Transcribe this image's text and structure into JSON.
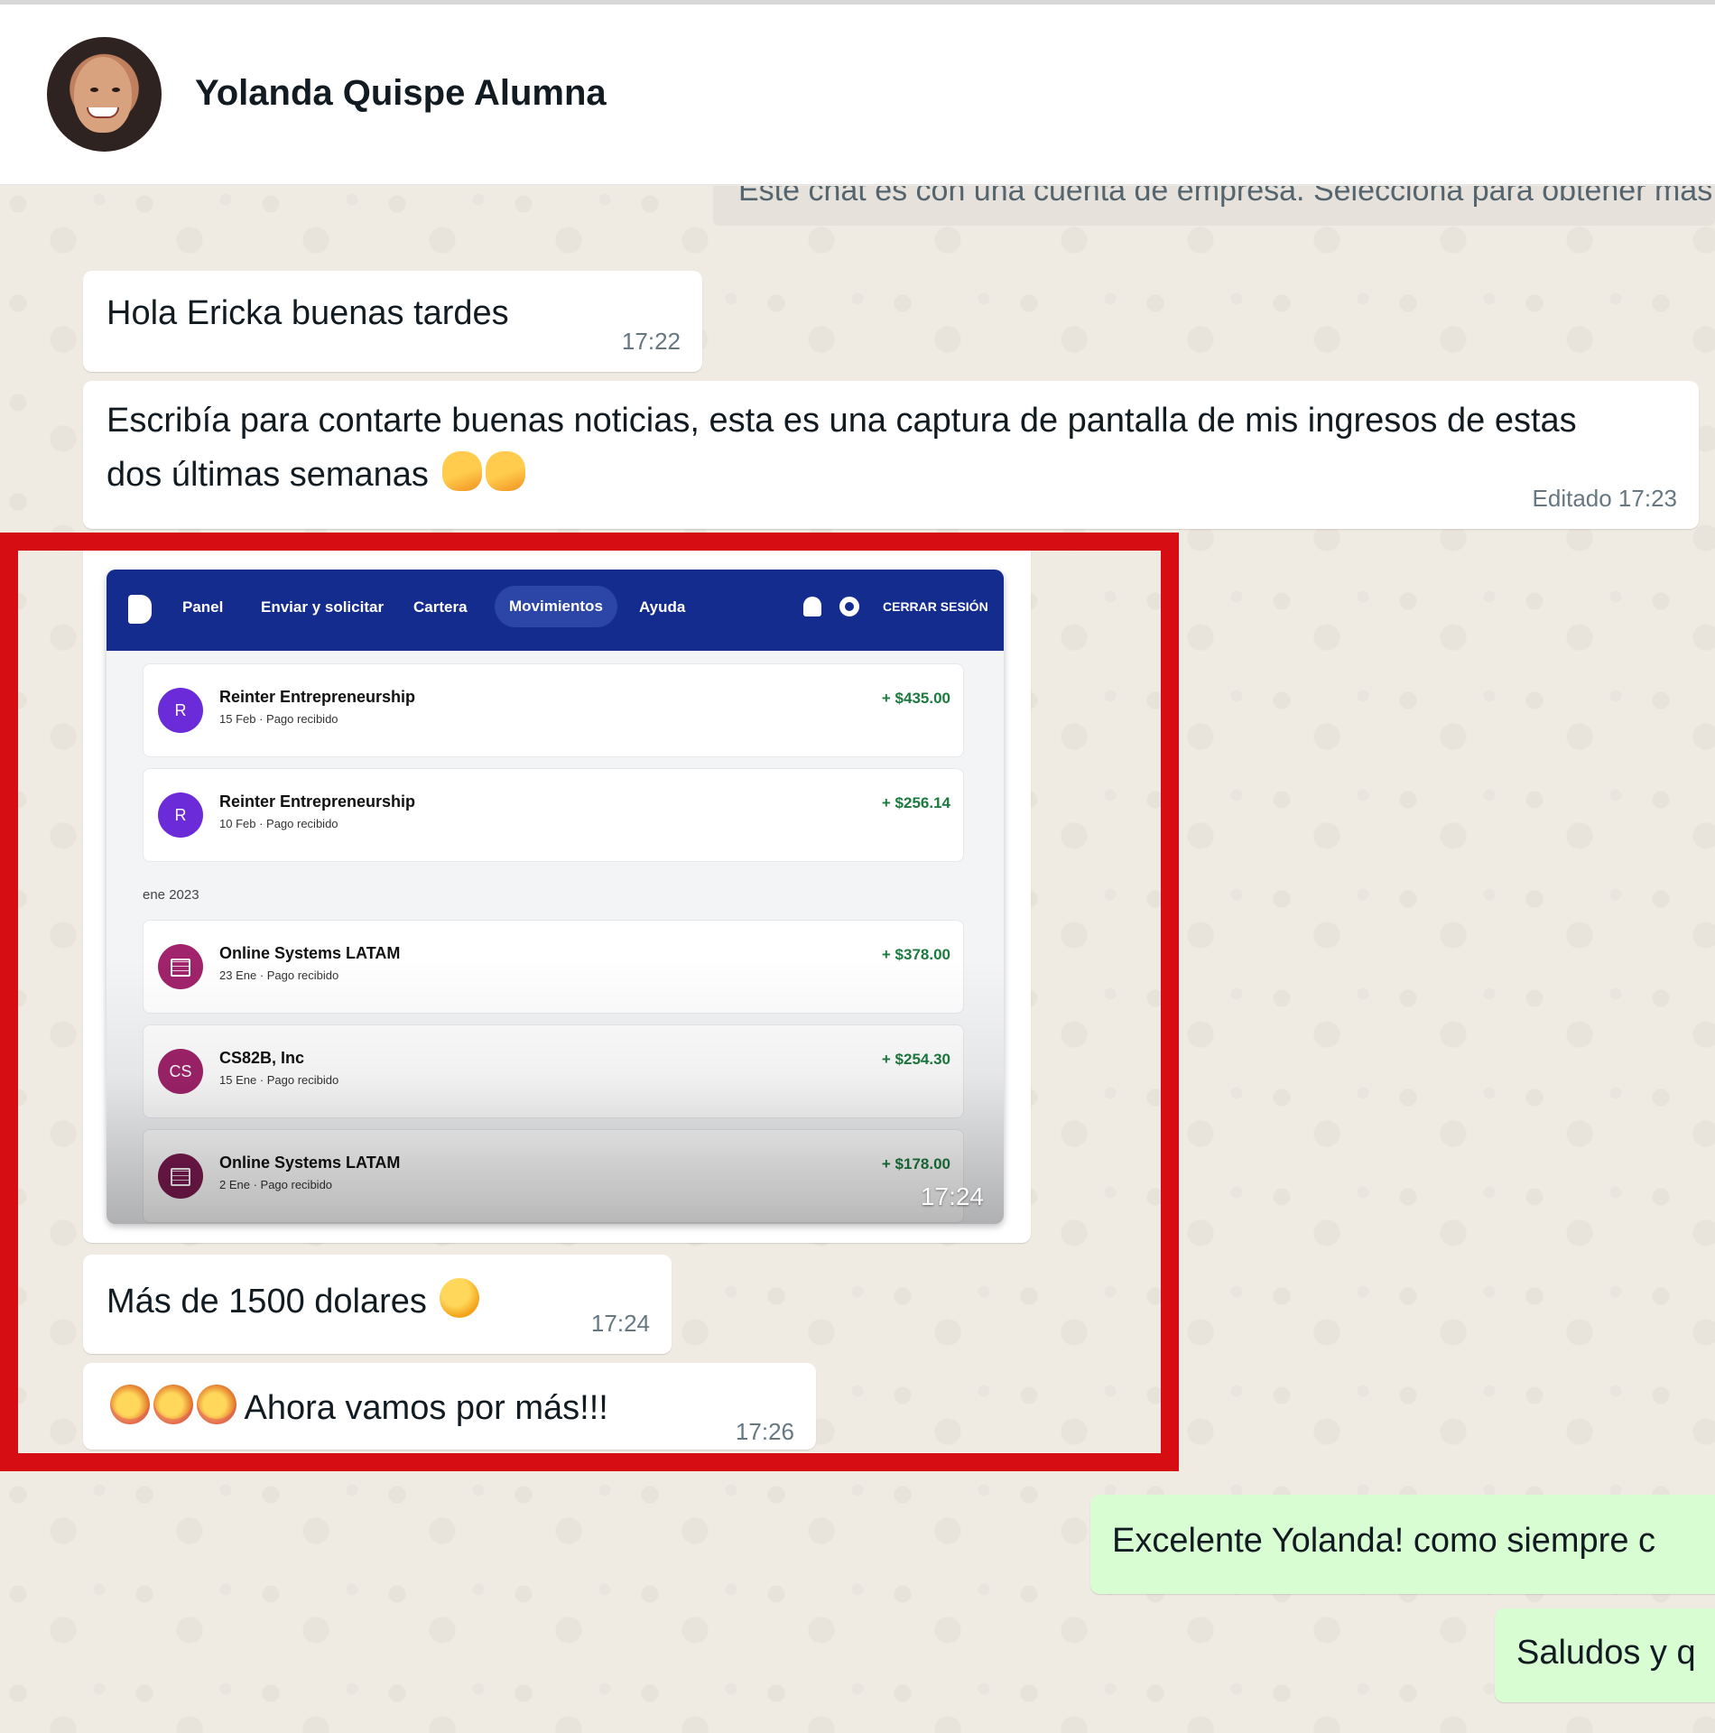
{
  "header": {
    "contact_name": "Yolanda Quispe Alumna"
  },
  "system_notice": "Este chat es con una cuenta de empresa. Selecciona para obtener más información.",
  "messages": [
    {
      "text": "Hola Ericka buenas tardes",
      "time": "17:22"
    },
    {
      "text": "Escribía para contarte buenas noticias, esta es una captura de pantalla de mis ingresos de estas dos últimas semanas",
      "time": "Editado 17:23",
      "emoji": "👍👍"
    },
    {
      "image": true,
      "time": "17:24"
    },
    {
      "text": "Más de 1500 dolares",
      "time": "17:24",
      "emoji": "🙌"
    },
    {
      "text": "Ahora vamos por más!!!",
      "time": "17:26",
      "emoji": "🥳🥳🥳"
    },
    {
      "text": "Excelente Yolanda! como siempre c",
      "outgoing": true
    },
    {
      "text": "Saludos y q",
      "outgoing": true
    }
  ],
  "screenshot": {
    "nav": [
      "Panel",
      "Enviar y solicitar",
      "Cartera",
      "Movimientos",
      "Ayuda"
    ],
    "active_nav": "Movimientos",
    "logout": "CERRAR SESIÓN",
    "section_label": "ene 2023",
    "transactions": [
      {
        "initial": "R",
        "name": "Reinter Entrepreneurship",
        "sub": "15 Feb · Pago recibido",
        "amount": "+ $435.00"
      },
      {
        "initial": "R",
        "name": "Reinter Entrepreneurship",
        "sub": "10 Feb · Pago recibido",
        "amount": "+ $256.14"
      },
      {
        "initial": "",
        "name": "Online Systems LATAM",
        "sub": "23 Ene · Pago recibido",
        "amount": "+ $378.00"
      },
      {
        "initial": "CS",
        "name": "CS82B, Inc",
        "sub": "15 Ene · Pago recibido",
        "amount": "+ $254.30"
      },
      {
        "initial": "",
        "name": "Online Systems LATAM",
        "sub": "2 Ene · Pago recibido",
        "amount": "+ $178.00"
      }
    ]
  },
  "colors": {
    "chat_bg": "#efeae2",
    "bubble_in": "#ffffff",
    "bubble_out": "#d9fdd3",
    "highlight": "#d60d12",
    "paypal_nav": "#142c8e",
    "amount_green": "#1b7a3e"
  }
}
